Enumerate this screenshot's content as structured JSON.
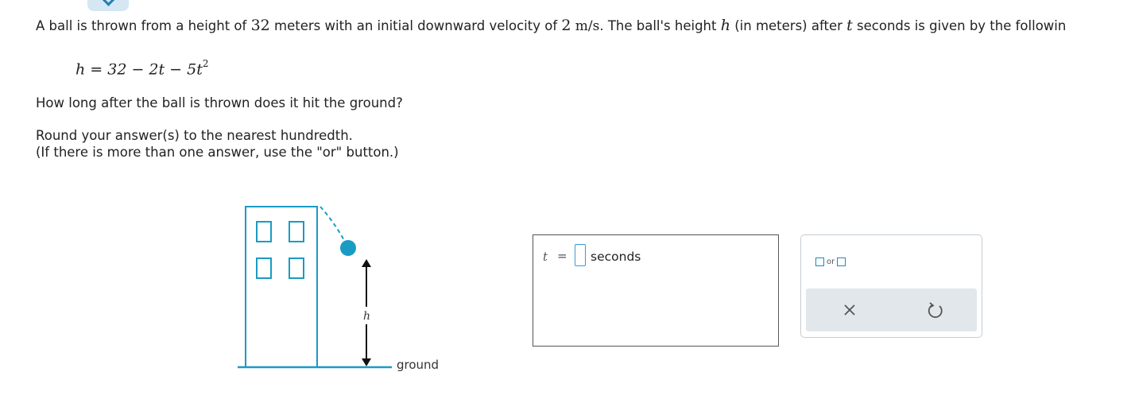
{
  "problem": {
    "line1_a": "A ball is thrown from a height of ",
    "height_value": "32",
    "line1_b": " meters with an initial downward velocity of ",
    "velocity_value": "2",
    "velocity_unit": "m/s",
    "line1_c": ". The ball's height ",
    "h_var": "h",
    "line1_d": " (in meters) after ",
    "t_var": "t",
    "line1_e": " seconds is given by the followin",
    "equation_main": "h = 32 − 2t − 5t",
    "equation_exp": "2",
    "question": "How long after the ball is thrown does it hit the ground?",
    "round_line1": "Round your answer(s) to the nearest hundredth.",
    "round_line2": "(If there is more than one answer, use the \"or\" button.)"
  },
  "diagram": {
    "h_label": "h",
    "ground_label": "ground",
    "ball_color": "#1a9bc4",
    "building_color": "#1a9bc4"
  },
  "answer": {
    "t_label": "t",
    "equals": "=",
    "value": "",
    "unit": "seconds"
  },
  "tools": {
    "or_label": "or",
    "clear_icon": "close-icon",
    "undo_icon": "undo-icon"
  },
  "colors": {
    "accent": "#1e88c9",
    "toolbar_bg": "#e1e7ea"
  }
}
